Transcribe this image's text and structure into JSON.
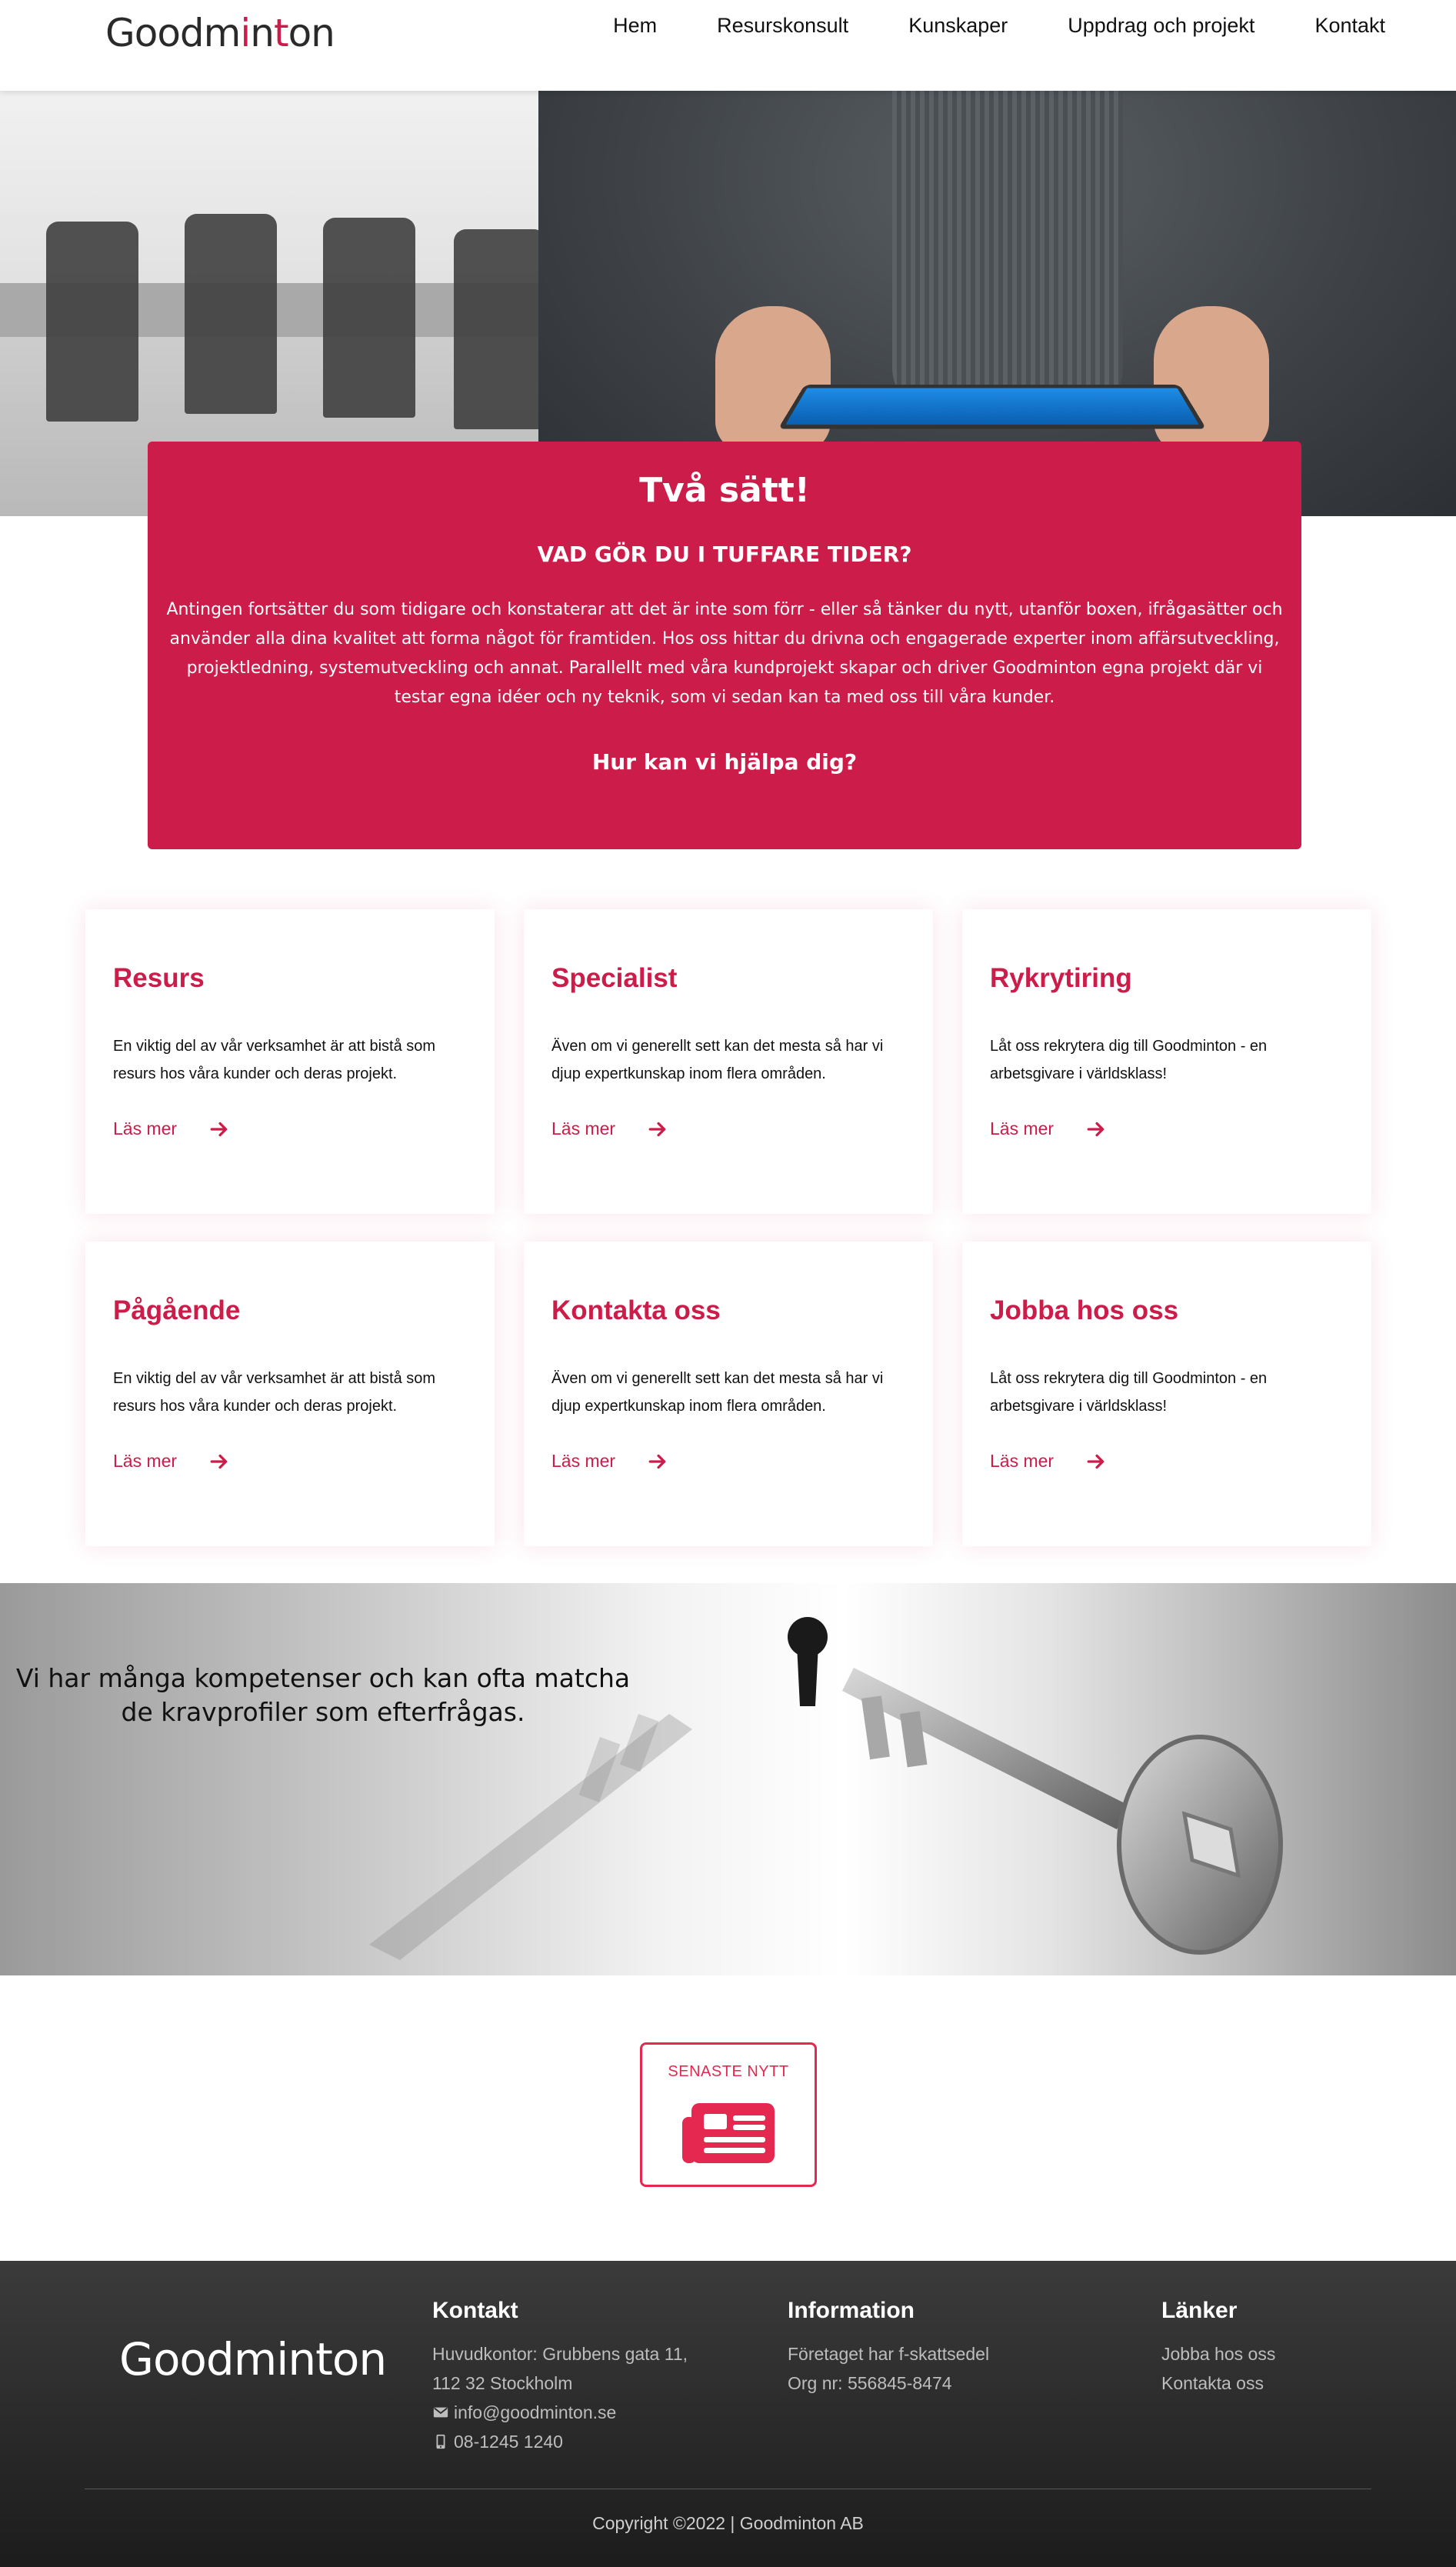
{
  "brand": {
    "logo_prefix": "Goodm",
    "logo_hl1": "i",
    "logo_mid": "n",
    "logo_hl2": "t",
    "logo_suffix": "on",
    "accent": "#cc1c4a"
  },
  "nav": {
    "items": [
      "Hem",
      "Resurskonsult",
      "Kunskaper",
      "Uppdrag och projekt",
      "Kontakt"
    ]
  },
  "intro": {
    "title": "Två sätt!",
    "subtitle": "VAD GÖR DU I TUFFARE TIDER?",
    "body": "Antingen fortsätter du som tidigare och konstaterar att det är inte som förr - eller så tänker du nytt, utanför boxen, ifrågasätter och använder alla dina kvalitet att forma något för framtiden. Hos oss hittar du drivna och engagerade experter inom affärsutveckling, projektledning, systemutveckling och annat. Parallellt med våra kundprojekt skapar och driver Goodminton egna projekt där vi testar egna idéer och ny teknik, som vi sedan kan ta med oss till våra kunder.",
    "question": "Hur kan vi hjälpa dig?"
  },
  "cards": [
    {
      "title": "Resurs",
      "desc": "En viktig del av vår verksamhet är att bistå som resurs hos våra kunder och deras projekt.",
      "link": "Läs mer"
    },
    {
      "title": "Specialist",
      "desc": "Även om vi generellt sett kan det mesta så har vi djup expertkunskap inom flera områden.",
      "link": "Läs mer"
    },
    {
      "title": "Rykrytiring",
      "desc": "Låt oss rekrytera dig till Goodminton - en arbetsgivare i världsklass!",
      "link": "Läs mer"
    },
    {
      "title": "Pågående",
      "desc": "En viktig del av vår verksamhet är att bistå som resurs hos våra kunder och deras projekt.",
      "link": "Läs mer"
    },
    {
      "title": "Kontakta oss",
      "desc": "Även om vi generellt sett kan det mesta så har vi djup expertkunskap inom flera områden.",
      "link": "Läs mer"
    },
    {
      "title": "Jobba hos oss",
      "desc": "Låt oss rekrytera dig till Goodminton - en arbetsgivare i världsklass!",
      "link": "Läs mer"
    }
  ],
  "banner": {
    "text": "Vi har många kompetenser och kan ofta matcha de kravprofiler som efterfrågas."
  },
  "news": {
    "label": "SENASTE NYTT",
    "icon": "newspaper-icon"
  },
  "footer": {
    "logo": "Goodminton",
    "contact": {
      "heading": "Kontakt",
      "address_1": "Huvudkontor: Grubbens gata 11,",
      "address_2": "112 32 Stockholm",
      "email": "info@goodminton.se",
      "phone": "08-1245 1240"
    },
    "information": {
      "heading": "Information",
      "line_1": "Företaget har f-skattsedel",
      "line_2": "Org nr: 556845-8474"
    },
    "links": {
      "heading": "Länker",
      "items": [
        "Jobba hos oss",
        "Kontakta oss"
      ]
    },
    "copyright": "Copyright ©2022 | Goodminton AB"
  }
}
